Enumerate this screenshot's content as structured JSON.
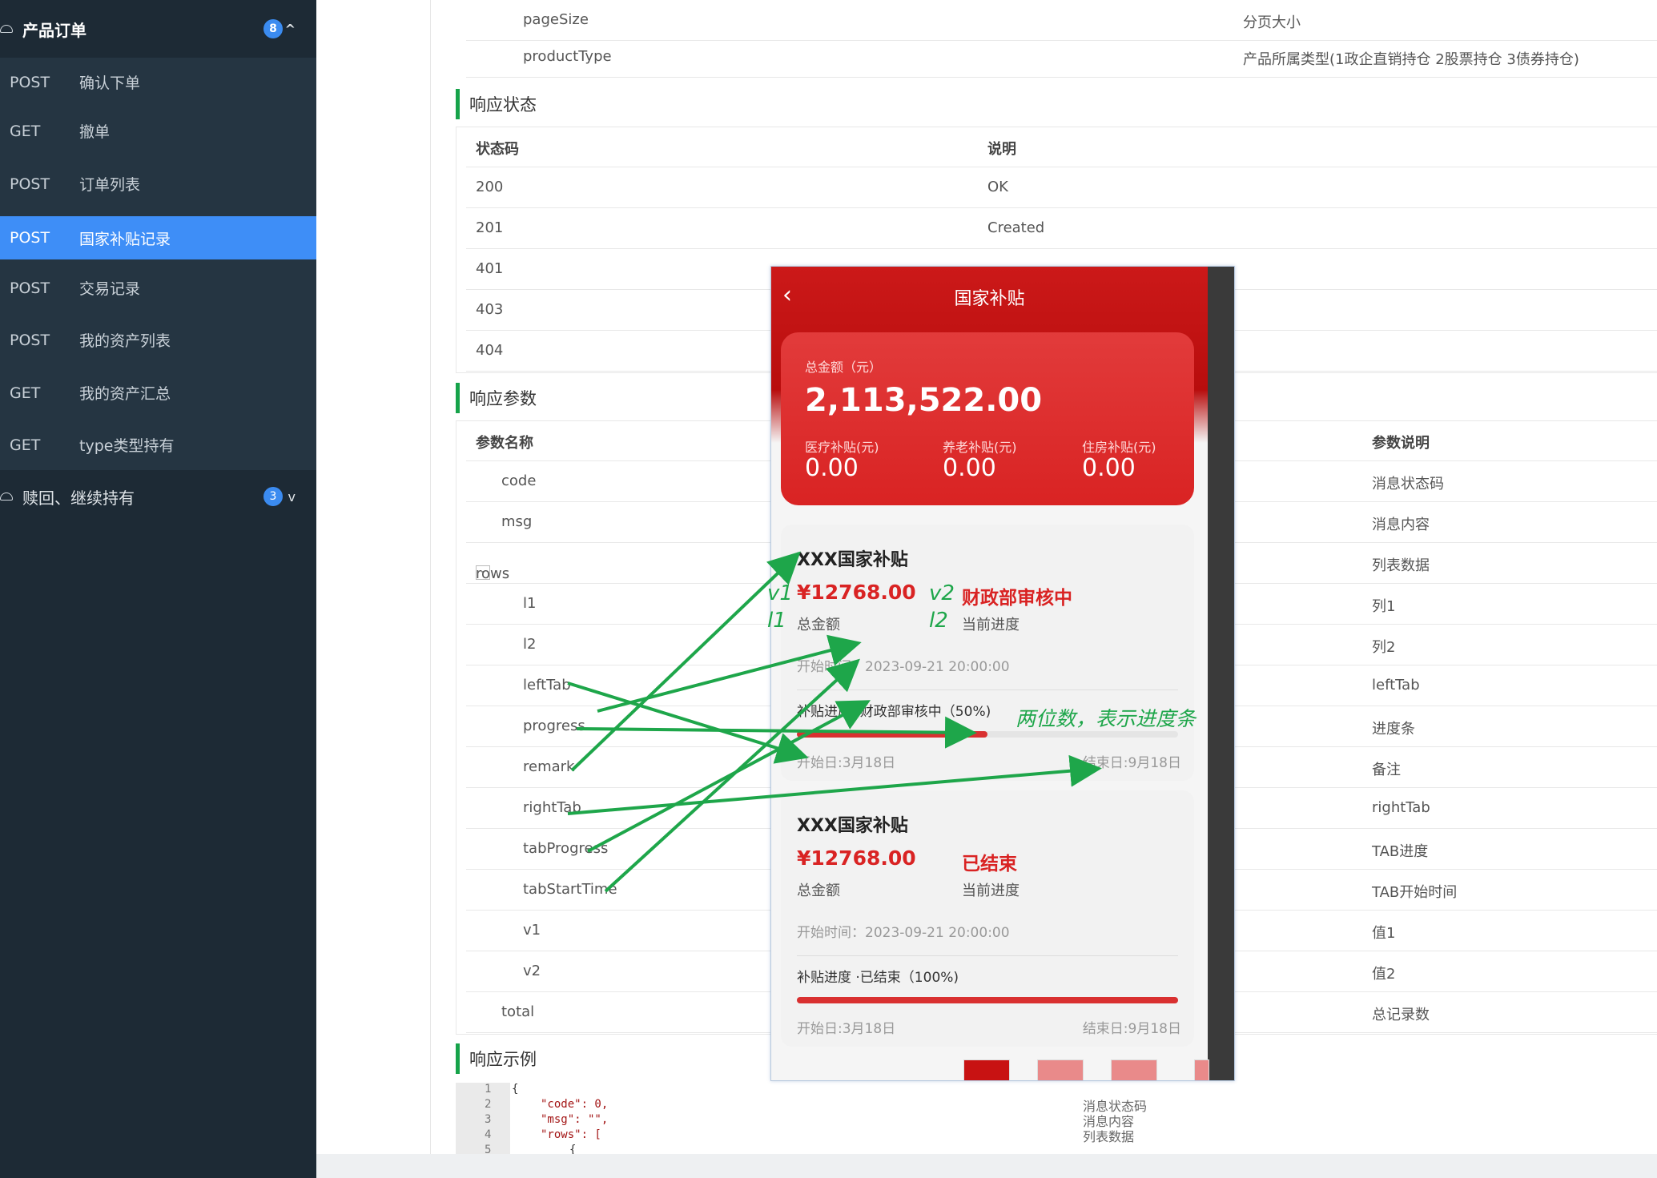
{
  "sidebar": {
    "group1": {
      "label": "产品订单",
      "badge": "8",
      "chevron": "^"
    },
    "items": [
      {
        "method": "POST",
        "label": "确认下单"
      },
      {
        "method": "GET",
        "label": "撤单"
      },
      {
        "method": "POST",
        "label": "订单列表"
      },
      {
        "method": "POST",
        "label": "国家补贴记录",
        "active": true
      },
      {
        "method": "POST",
        "label": "交易记录"
      },
      {
        "method": "POST",
        "label": "我的资产列表"
      },
      {
        "method": "GET",
        "label": "我的资产汇总"
      },
      {
        "method": "GET",
        "label": "type类型持有"
      }
    ],
    "group2": {
      "label": "赎回、继续持有",
      "badge": "3",
      "chevron": "v"
    }
  },
  "request_params": [
    {
      "name": "pageSize",
      "desc": "分页大小"
    },
    {
      "name": "productType",
      "desc": "产品所属类型(1政企直销持仓 2股票持仓 3债券持仓)"
    }
  ],
  "response_status": {
    "title": "响应状态",
    "headers": {
      "code": "状态码",
      "desc": "说明"
    },
    "rows": [
      {
        "code": "200",
        "desc": "OK"
      },
      {
        "code": "201",
        "desc": "Created"
      },
      {
        "code": "401",
        "desc": ""
      },
      {
        "code": "403",
        "desc": ""
      },
      {
        "code": "404",
        "desc": ""
      }
    ]
  },
  "response_params": {
    "title": "响应参数",
    "headers": {
      "name": "参数名称",
      "desc": "参数说明"
    },
    "rows": [
      {
        "name": "code",
        "desc": "消息状态码"
      },
      {
        "name": "msg",
        "desc": "消息内容"
      },
      {
        "name": "rows",
        "desc": "列表数据",
        "toggle": "-"
      },
      {
        "name": "l1",
        "desc": "列1"
      },
      {
        "name": "l2",
        "desc": "列2"
      },
      {
        "name": "leftTab",
        "desc": "leftTab"
      },
      {
        "name": "progress",
        "desc": "进度条"
      },
      {
        "name": "remark",
        "desc": "备注"
      },
      {
        "name": "rightTab",
        "desc": "rightTab"
      },
      {
        "name": "tabProgress",
        "desc": "TAB进度"
      },
      {
        "name": "tabStartTime",
        "desc": "TAB开始时间"
      },
      {
        "name": "v1",
        "desc": "值1"
      },
      {
        "name": "v2",
        "desc": "值2"
      },
      {
        "name": "total",
        "desc": "总记录数"
      }
    ]
  },
  "response_example": {
    "title": "响应示例",
    "line_numbers": [
      "1",
      "2",
      "3",
      "4",
      "5"
    ],
    "code_lines": [
      "{",
      "\"code\": 0,",
      "\"msg\": \"\",",
      "\"rows\": [",
      "{"
    ],
    "side_notes": [
      "消息状态码",
      "消息内容",
      "列表数据"
    ]
  },
  "phone": {
    "title": "国家补贴",
    "summary": {
      "total_label": "总金额（元）",
      "total_value": "2,113,522.00",
      "subs": [
        {
          "label": "医疗补贴(元)",
          "value": "0.00"
        },
        {
          "label": "养老补贴(元)",
          "value": "0.00"
        },
        {
          "label": "住房补贴(元)",
          "value": "0.00"
        }
      ]
    },
    "cards": [
      {
        "title": "XXX国家补贴",
        "amount": "¥12768.00",
        "status": "财政部审核中",
        "amount_label": "总金额",
        "status_label": "当前进度",
        "start_time": "开始时间：2023-09-21 20:00:00",
        "progress_label": "补贴进度 ·财政部审核中（50%)",
        "progress": 0.5,
        "start_day": "开始日:3月18日",
        "end_day": "结束日:9月18日"
      },
      {
        "title": "XXX国家补贴",
        "amount": "¥12768.00",
        "status": "已结束",
        "amount_label": "总金额",
        "status_label": "当前进度",
        "start_time": "开始时间：2023-09-21 20:00:00",
        "progress_label": "补贴进度 ·已结束（100%)",
        "progress": 1.0,
        "start_day": "开始日:3月18日",
        "end_day": "结束日:9月18日"
      }
    ]
  },
  "annotations": {
    "v1": "v1",
    "l1": "l1",
    "v2": "v2",
    "l2": "l2",
    "note": "两位数，表示进度条"
  },
  "colors": {
    "accent": "#3e8ef7",
    "sidebar": "#1d2a35",
    "section_bar": "#16a34a",
    "phone_red": "#d92323",
    "annotation_green": "#1ea64a"
  }
}
